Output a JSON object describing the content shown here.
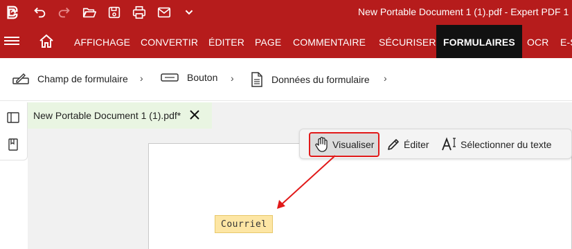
{
  "titlebar": {
    "title": "New Portable Document 1 (1).pdf   -   Expert PDF 1",
    "icons": [
      "app-logo-icon",
      "undo-icon",
      "redo-icon",
      "open-folder-icon",
      "save-icon",
      "print-icon",
      "email-icon",
      "chevron-down-icon"
    ]
  },
  "menubar": {
    "items": [
      {
        "label": "AFFICHAGE"
      },
      {
        "label": "CONVERTIR"
      },
      {
        "label": "ÉDITER"
      },
      {
        "label": "PAGE"
      },
      {
        "label": "COMMENTAIRE"
      },
      {
        "label": "SÉCURISER"
      },
      {
        "label": "FORMULAIRES",
        "active": true
      },
      {
        "label": "OCR"
      },
      {
        "label": "E-S"
      }
    ]
  },
  "subtoolbar": {
    "items": [
      {
        "label": "Champ de formulaire",
        "icon": "form-field-icon"
      },
      {
        "label": "Bouton",
        "icon": "button-icon"
      },
      {
        "label": "Données du formulaire",
        "icon": "form-data-icon"
      }
    ]
  },
  "document": {
    "tab_title": "New Portable Document 1 (1).pdf*",
    "field_label": "Courriel"
  },
  "viewbar": {
    "visualiser": "Visualiser",
    "editer": "Éditer",
    "selectionner": "Sélectionner du texte"
  },
  "colors": {
    "brand_red": "#b61c1c",
    "active_tab": "#111111",
    "highlight_outline": "#e11919",
    "field_fill": "#fde6a4"
  }
}
